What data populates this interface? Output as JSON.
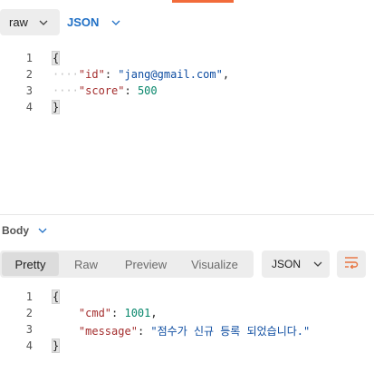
{
  "request": {
    "body_mode": "raw",
    "language": "JSON",
    "lines": [
      {
        "n": "1",
        "brace": "{"
      },
      {
        "n": "2",
        "key": "\"id\"",
        "sep": ": ",
        "value": "\"jang@gmail.com\"",
        "tail": ","
      },
      {
        "n": "3",
        "key": "\"score\"",
        "sep": ": ",
        "value": "500"
      },
      {
        "n": "4",
        "brace": "}"
      }
    ]
  },
  "response": {
    "section_label": "Body",
    "tabs": [
      "Pretty",
      "Raw",
      "Preview",
      "Visualize"
    ],
    "active_tab": "Pretty",
    "format": "JSON",
    "lines": [
      {
        "n": "1",
        "brace": "{"
      },
      {
        "n": "2",
        "key": "\"cmd\"",
        "sep": ": ",
        "value": "1001",
        "tail": ","
      },
      {
        "n": "3",
        "key": "\"message\"",
        "sep": ": ",
        "value": "\"점수가 신규 등록 되었습니다.\""
      },
      {
        "n": "4",
        "brace": "}"
      }
    ]
  },
  "colors": {
    "accent": "#f26b3a",
    "link_blue": "#1f6fc5",
    "json_key": "#a42e2e",
    "json_string": "#0e4da1",
    "json_number": "#07866b"
  },
  "icons": [
    "chevron-down-icon",
    "wrap-lines-icon"
  ]
}
